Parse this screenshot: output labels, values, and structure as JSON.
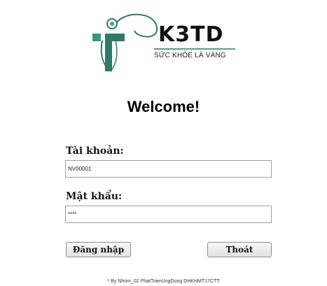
{
  "logo": {
    "brand": "K3TD",
    "slogan": "SỨC KHỎE LÀ VÀNG",
    "accent_color": "#3a8a74"
  },
  "welcome": "Welcome!",
  "account": {
    "label": "Tài khoản:",
    "value": "NV00001"
  },
  "password": {
    "label": "Mật khẩu:",
    "value": "****"
  },
  "buttons": {
    "login": "Đăng nhập",
    "exit": "Thoát"
  },
  "footer": "* By Nhom_02 PhatTrienUngDung DHKHMT17CTT"
}
